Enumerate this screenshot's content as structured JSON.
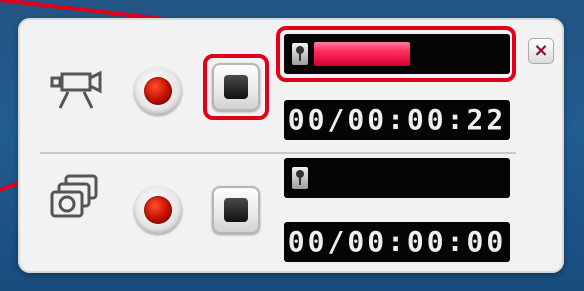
{
  "video_row": {
    "progress_fraction": 0.51,
    "timer_text": "00/00:00:22"
  },
  "photo_row": {
    "progress_fraction": 0.0,
    "timer_text": "00/00:00:00"
  },
  "close_label": "×",
  "icons": {
    "video": "video-camera-icon",
    "photo": "photo-camera-icon",
    "record": "record-icon",
    "stop": "stop-icon",
    "key": "key-icon"
  },
  "colors": {
    "highlight": "#e0001a",
    "progress_fill": "#ff2a5c",
    "record_red": "#c31200",
    "background": "#1b5a92"
  }
}
